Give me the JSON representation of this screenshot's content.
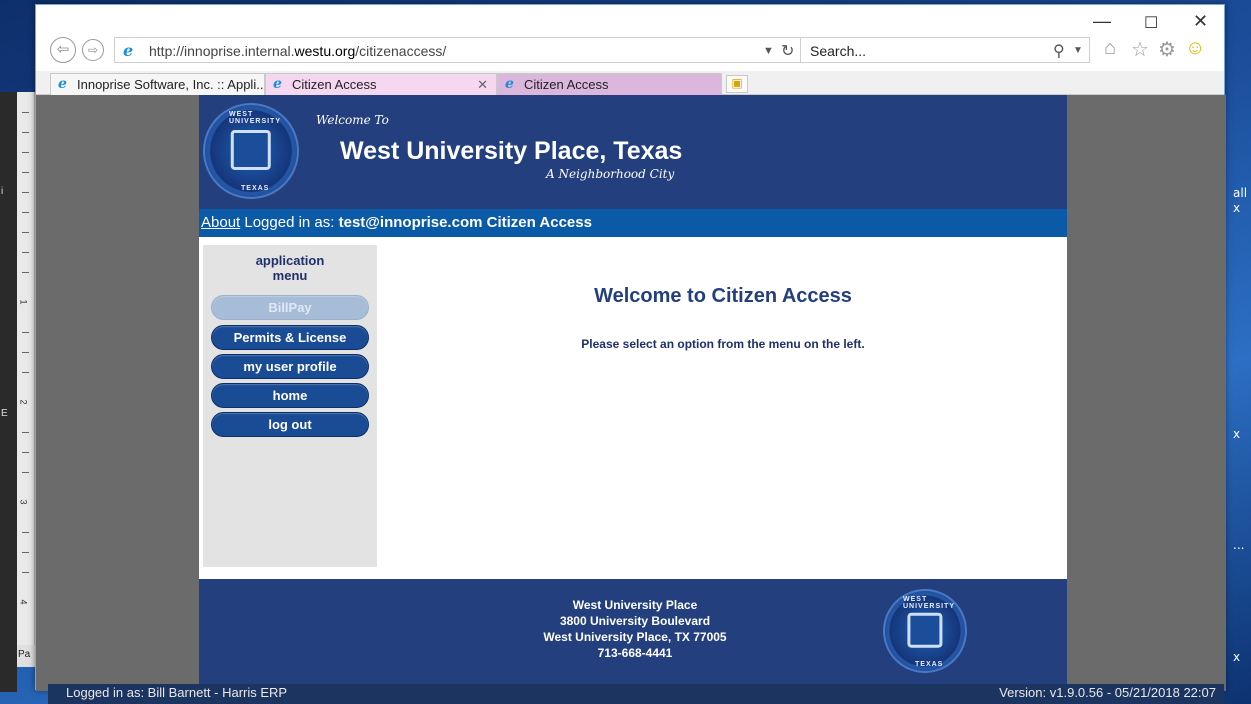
{
  "browser": {
    "url_prefix": "http://innoprise.internal.",
    "url_domain": "westu.org",
    "url_path": "/citizenaccess/",
    "search_placeholder": "Search...",
    "tabs": [
      {
        "label": "Innoprise Software, Inc. :: Appli..."
      },
      {
        "label": "Citizen Access"
      },
      {
        "label": "Citizen Access"
      }
    ]
  },
  "header": {
    "welcome_to": "Welcome To",
    "city_title": "West University Place, Texas",
    "tagline": "A Neighborhood City",
    "seal_top_text": "WEST UNIVERSITY",
    "seal_bottom_text": "TEXAS"
  },
  "login_bar": {
    "about_link": "About",
    "logged_in_label": " Logged in as: ",
    "user": "test@innoprise.com",
    "app_name": " Citizen Access"
  },
  "menu": {
    "title_line1": "application",
    "title_line2": "menu",
    "items": [
      {
        "label": "BillPay",
        "enabled": false
      },
      {
        "label": "Permits & License",
        "enabled": true
      },
      {
        "label": "my user profile",
        "enabled": true
      },
      {
        "label": "home",
        "enabled": true
      },
      {
        "label": "log out",
        "enabled": true
      }
    ]
  },
  "main": {
    "title": "Welcome to Citizen Access",
    "subtitle": "Please select an option from the menu on the left."
  },
  "footer": {
    "line1": "West University Place",
    "line2": "3800 University Boulevard",
    "line3": "West University Place, TX 77005",
    "line4": "713-668-4441"
  },
  "statusbar": {
    "left": "Logged in as: Bill Barnett - Harris ERP",
    "right": "Version: v1.9.0.56 - 05/21/2018 22:07"
  },
  "background": {
    "desktop_right_1": "all",
    "desktop_right_2": "x",
    "desktop_right_3": "x",
    "desktop_right_4": "...",
    "desktop_right_5": "x",
    "doc_label": "Pa",
    "ruler_nums": [
      "1",
      "2",
      "3",
      "4"
    ],
    "side_letters": [
      "i",
      "E"
    ]
  },
  "colors": {
    "header_blue": "#233f7d",
    "login_bar_blue": "#0b5aa8",
    "menu_button_blue": "#1a4b95"
  }
}
